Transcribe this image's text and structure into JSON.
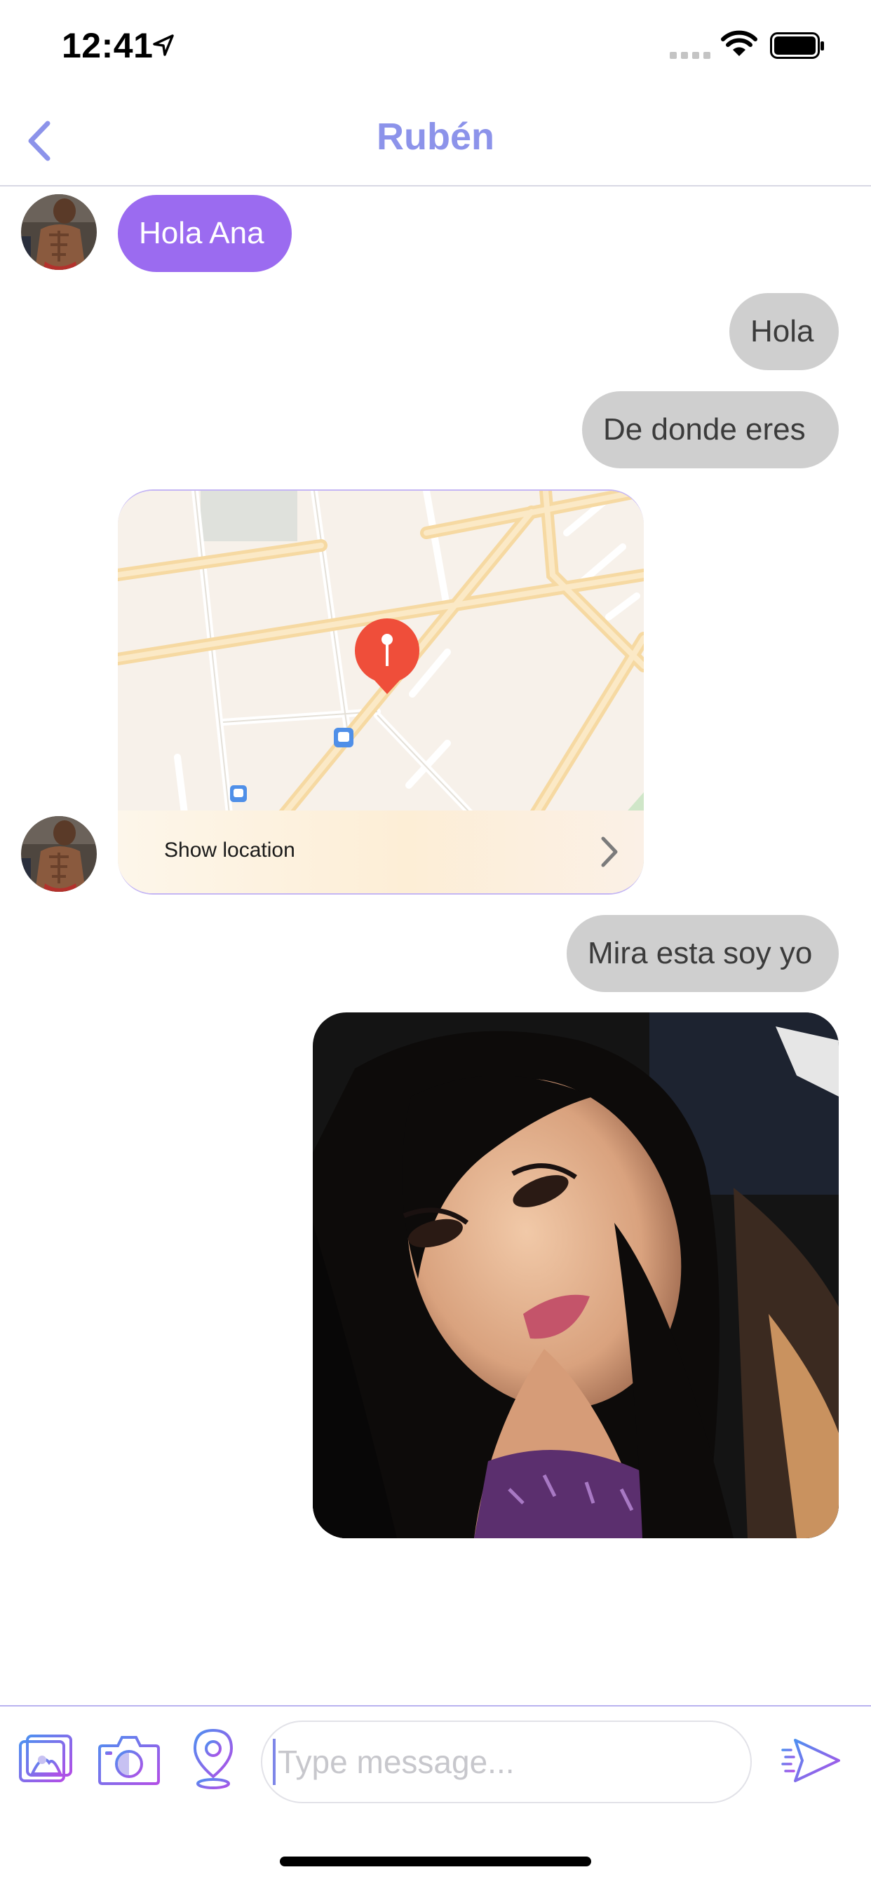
{
  "status_bar": {
    "time": "12:41"
  },
  "header": {
    "title": "Rubén"
  },
  "messages": [
    {
      "direction": "incoming",
      "text": "Hola Ana"
    },
    {
      "direction": "outgoing",
      "text": "Hola"
    },
    {
      "direction": "outgoing",
      "text": "De donde eres"
    },
    {
      "direction": "incoming",
      "type": "location",
      "action_label": "Show location"
    },
    {
      "direction": "outgoing",
      "text": "Mira esta soy yo"
    },
    {
      "direction": "outgoing",
      "type": "photo"
    }
  ],
  "composer": {
    "placeholder": "Type message..."
  },
  "colors": {
    "accent": "#8c93ea",
    "incoming_bubble": "#9b6bf0",
    "outgoing_bubble": "#cfcfcf",
    "pin": "#ef4e3a"
  },
  "icons": [
    "back-chevron-icon",
    "gallery-icon",
    "camera-icon",
    "location-pin-icon",
    "send-icon"
  ]
}
